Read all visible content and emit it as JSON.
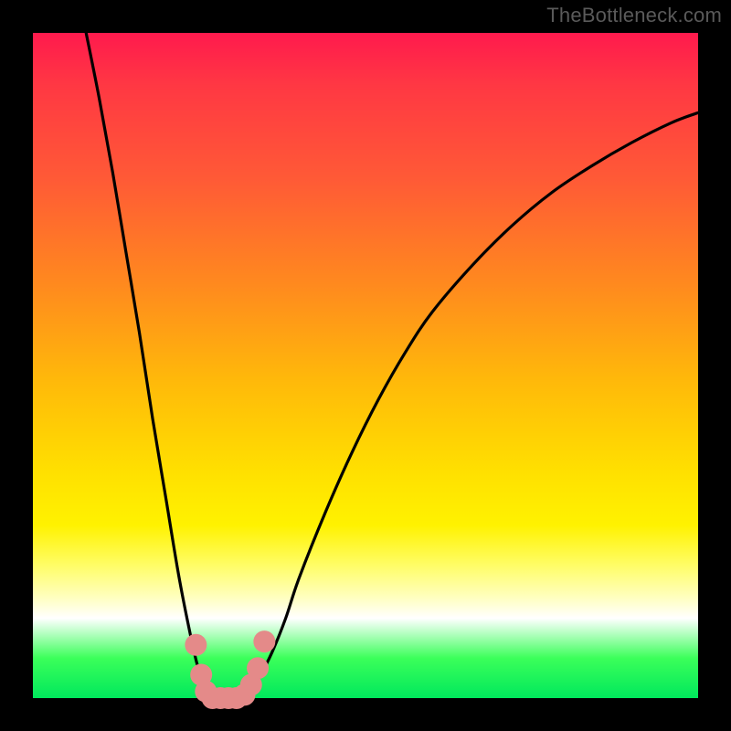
{
  "watermark": "TheBottleneck.com",
  "chart_data": {
    "type": "line",
    "title": "",
    "xlabel": "",
    "ylabel": "",
    "xlim": [
      0,
      100
    ],
    "ylim": [
      0,
      100
    ],
    "grid": false,
    "legend": false,
    "background_gradient": {
      "direction": "vertical",
      "stops": [
        {
          "pos": 0,
          "color": "#ff1a4d"
        },
        {
          "pos": 50,
          "color": "#ffd200"
        },
        {
          "pos": 88,
          "color": "#ffffff"
        },
        {
          "pos": 100,
          "color": "#00e85c"
        }
      ]
    },
    "series": [
      {
        "name": "bottleneck-curve",
        "color": "#000000",
        "x": [
          8,
          10,
          12,
          14,
          16,
          18,
          20,
          22,
          24,
          25,
          26,
          27,
          28,
          29,
          30,
          31,
          32,
          33,
          34,
          36,
          38,
          40,
          44,
          48,
          52,
          56,
          60,
          66,
          72,
          78,
          84,
          90,
          96,
          100
        ],
        "y": [
          100,
          90,
          79,
          67,
          55,
          42,
          30,
          18,
          8,
          4,
          1.5,
          0.5,
          0,
          0,
          0,
          0,
          0.5,
          1.5,
          3,
          7,
          12,
          18,
          28,
          37,
          45,
          52,
          58,
          65,
          71,
          76,
          80,
          83.5,
          86.5,
          88
        ]
      },
      {
        "name": "highlight-dots",
        "color": "#e48a89",
        "type": "scatter",
        "marker_size": 12,
        "x": [
          24.5,
          25.3,
          26.0,
          27.0,
          28.2,
          29.4,
          30.6,
          31.8,
          32.8,
          33.8,
          34.8
        ],
        "y": [
          8.0,
          3.5,
          1.0,
          0.0,
          0.0,
          0.0,
          0.0,
          0.5,
          2.0,
          4.5,
          8.5
        ]
      }
    ]
  }
}
